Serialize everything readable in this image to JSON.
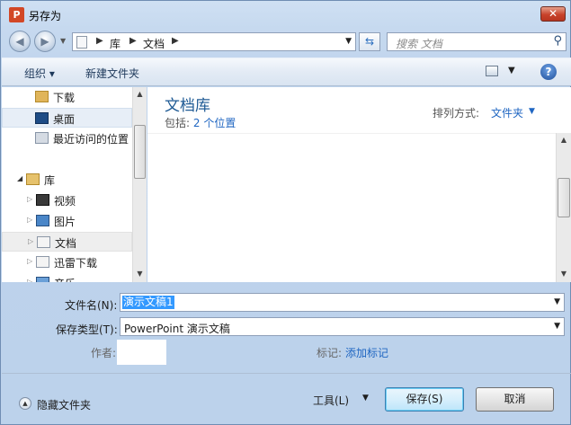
{
  "window": {
    "title": "另存为",
    "app_icon_text": "P"
  },
  "address": {
    "parts": [
      "库",
      "文档"
    ],
    "search_placeholder": "搜索 文档"
  },
  "toolbar": {
    "organize": "组织 ▾",
    "new_folder": "新建文件夹"
  },
  "nav": {
    "items": [
      {
        "label": "下载"
      },
      {
        "label": "桌面"
      },
      {
        "label": "最近访问的位置"
      },
      {
        "label": "库"
      },
      {
        "label": "视频"
      },
      {
        "label": "图片"
      },
      {
        "label": "文档"
      },
      {
        "label": "迅雷下载"
      },
      {
        "label": "音乐"
      }
    ]
  },
  "content": {
    "library_title": "文档库",
    "includes_label": "包括:",
    "includes_link": "2 个位置",
    "arrange_label": "排列方式:",
    "arrange_value": "文件夹"
  },
  "form": {
    "filename_label": "文件名(N):",
    "filename_value": "演示文稿1",
    "filetype_label": "保存类型(T):",
    "filetype_value": "PowerPoint 演示文稿",
    "author_label": "作者:",
    "tags_label": "标记:",
    "tags_link": "添加标记"
  },
  "footer": {
    "hide_folders": "隐藏文件夹",
    "tools": "工具(L)",
    "save": "保存(S)",
    "cancel": "取消"
  },
  "colors": {
    "accent": "#1f66c2",
    "selection": "#3399ff",
    "title_green": "#1e5a94"
  }
}
